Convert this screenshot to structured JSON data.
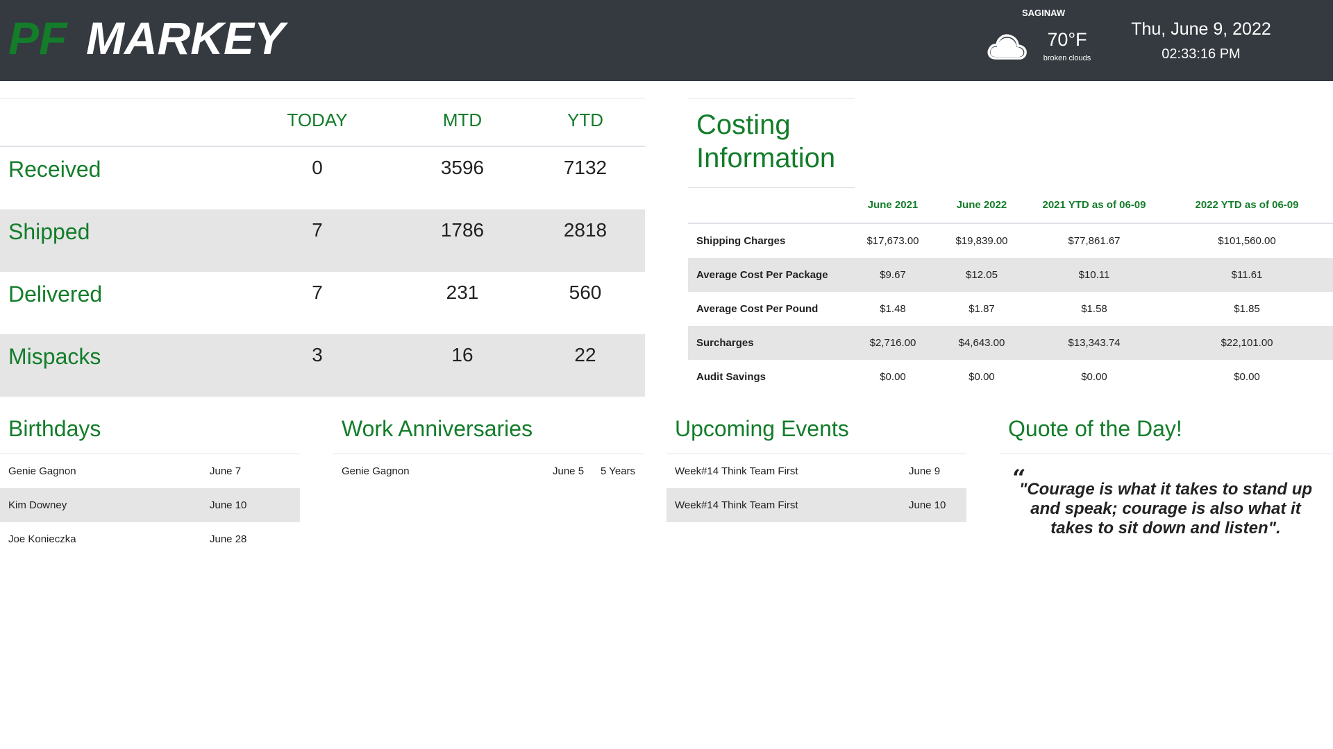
{
  "header": {
    "logo": {
      "part1": "PF",
      "part2": "MARKEY"
    },
    "weather": {
      "city": "SAGINAW",
      "temp": "70°F",
      "description": "broken clouds",
      "icon": "cloud-icon"
    },
    "date": "Thu, June 9, 2022",
    "time": "02:33:16 PM"
  },
  "stats": {
    "columns": [
      "TODAY",
      "MTD",
      "YTD"
    ],
    "rows": [
      {
        "label": "Received",
        "values": [
          "0",
          "3596",
          "7132"
        ]
      },
      {
        "label": "Shipped",
        "values": [
          "7",
          "1786",
          "2818"
        ]
      },
      {
        "label": "Delivered",
        "values": [
          "7",
          "231",
          "560"
        ]
      },
      {
        "label": "Mispacks",
        "values": [
          "3",
          "16",
          "22"
        ]
      }
    ]
  },
  "costing": {
    "title": "Costing Information",
    "title_line1": "Costing",
    "title_line2": "Information",
    "columns": [
      "June 2021",
      "June 2022",
      "2021 YTD as of 06-09",
      "2022 YTD as of 06-09"
    ],
    "rows": [
      {
        "label": "Shipping Charges",
        "values": [
          "$17,673.00",
          "$19,839.00",
          "$77,861.67",
          "$101,560.00"
        ]
      },
      {
        "label": "Average Cost Per Package",
        "values": [
          "$9.67",
          "$12.05",
          "$10.11",
          "$11.61"
        ]
      },
      {
        "label": "Average Cost Per Pound",
        "values": [
          "$1.48",
          "$1.87",
          "$1.58",
          "$1.85"
        ]
      },
      {
        "label": "Surcharges",
        "values": [
          "$2,716.00",
          "$4,643.00",
          "$13,343.74",
          "$22,101.00"
        ]
      },
      {
        "label": "Audit Savings",
        "values": [
          "$0.00",
          "$0.00",
          "$0.00",
          "$0.00"
        ]
      }
    ]
  },
  "birthdays": {
    "title": "Birthdays",
    "items": [
      {
        "name": "Genie Gagnon",
        "date": "June 7"
      },
      {
        "name": "Kim Downey",
        "date": "June 10"
      },
      {
        "name": "Joe Konieczka",
        "date": "June 28"
      }
    ]
  },
  "anniversaries": {
    "title": "Work Anniversaries",
    "items": [
      {
        "name": "Genie Gagnon",
        "date": "June 5",
        "years": "5 Years"
      }
    ]
  },
  "events": {
    "title": "Upcoming Events",
    "items": [
      {
        "name": "Week#14 Think Team First",
        "date": "June 9"
      },
      {
        "name": "Week#14 Think Team First",
        "date": "June 10"
      }
    ]
  },
  "quote": {
    "title": "Quote of the Day!",
    "mark": "“",
    "text": "\"Courage is what it takes to stand up and speak; courage is also what it takes to sit down and listen\"."
  },
  "colors": {
    "accent": "#137d2a",
    "header_bg": "#343a40",
    "row_alt": "#e5e5e5"
  }
}
